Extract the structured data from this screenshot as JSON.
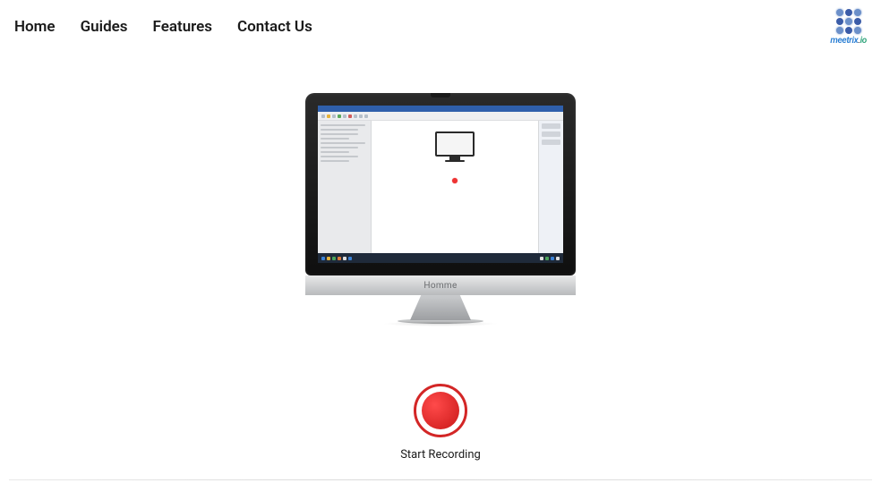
{
  "nav": {
    "home": "Home",
    "guides": "Guides",
    "features": "Features",
    "contact": "Contact Us"
  },
  "logo": {
    "brand_prefix": "meetrix",
    "brand_dot": ".",
    "brand_suffix": "io"
  },
  "monitor": {
    "chin_label": "Homme"
  },
  "record": {
    "label": "Start Recording"
  }
}
